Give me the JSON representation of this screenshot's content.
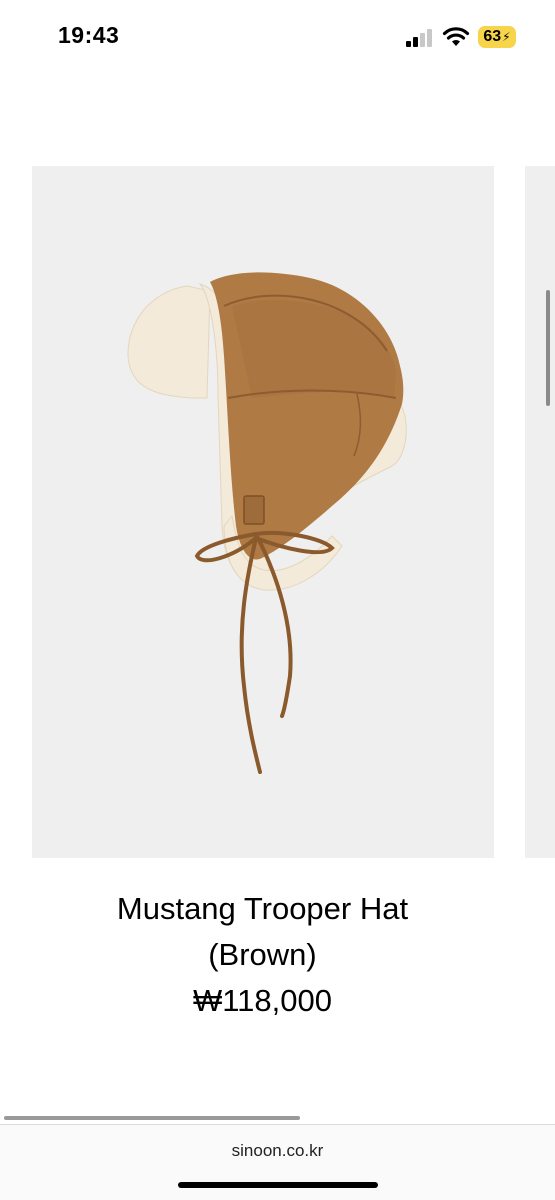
{
  "status_bar": {
    "time": "19:43",
    "battery_level": "63",
    "signal_icon": "cellular-signal-icon",
    "wifi_icon": "wifi-icon",
    "battery_color": "#f7d54a"
  },
  "product": {
    "name_line1": "Mustang Trooper Hat",
    "name_line2": "(Brown)",
    "price": "₩118,000",
    "image_icon": "trooper-hat-image",
    "hat_color": "#b07a45",
    "fur_color": "#f3ead9"
  },
  "browser": {
    "url": "sinoon.co.kr"
  }
}
